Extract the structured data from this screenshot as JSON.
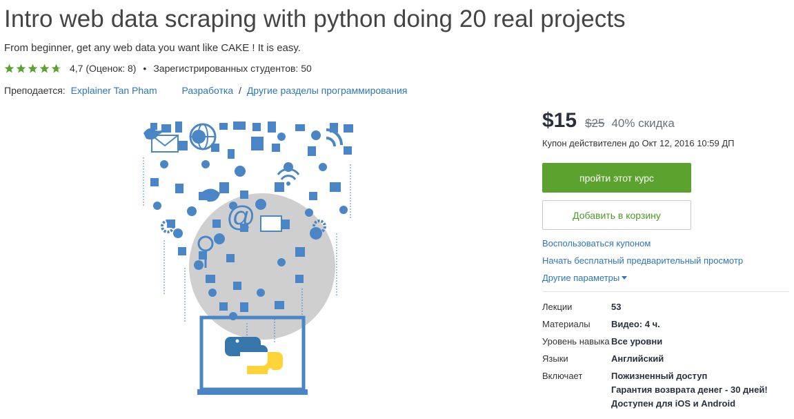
{
  "course": {
    "title": "Intro web data scraping with python doing 20 real projects",
    "subtitle": "From beginner, get any web data you want like CAKE ! It is easy.",
    "rating_text": "4,7 (Оценок: 8)",
    "rating_value": 4.7,
    "rating_max": 5,
    "students_text": "Зарегистрированных студентов: 50",
    "taught_by_label": "Преподается:",
    "instructor": "Explainer Tan Pham",
    "category_primary": "Разработка",
    "category_separator": "/",
    "category_secondary": "Другие разделы программирования"
  },
  "purchase": {
    "price": "$15",
    "old_price": "$25",
    "discount": "40% скидка",
    "coupon_valid": "Купон действителен до Окт 12, 2016 10:59 ДП",
    "take_course_label": "пройти этот курс",
    "add_to_cart_label": "Добавить в корзину",
    "apply_coupon_label": "Воспользоваться купоном",
    "free_preview_label": "Начать бесплатный предварительный просмотр",
    "more_options_label": "Другие параметры"
  },
  "details": {
    "lectures_label": "Лекции",
    "lectures_value": "53",
    "materials_label": "Материалы",
    "materials_value": "Видео: 4 ч.",
    "level_label": "Уровень навыка",
    "level_value": "Все уровни",
    "languages_label": "Языки",
    "languages_value": "Английский",
    "includes_label": "Включает",
    "includes_values": [
      "Пожизненный доступ",
      "Гарантия возврата денег - 30 дней!",
      "Доступен для iOS и Android"
    ]
  },
  "colors": {
    "accent_green": "#5ba22e",
    "star_green": "#5ba22e",
    "link_blue": "#2f76b7",
    "icon_blue": "#4a86c5",
    "python_blue": "#3776ab",
    "python_yellow": "#ffd43b"
  },
  "icons": [
    "star-icon",
    "caret-down-icon",
    "python-logo-icon",
    "laptop-icon",
    "twitter-bird-icon",
    "envelope-icon",
    "globe-icon",
    "wifi-icon",
    "at-sign-icon",
    "gear-icon"
  ]
}
